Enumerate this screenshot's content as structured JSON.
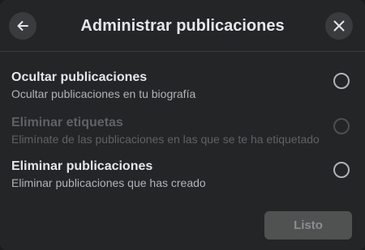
{
  "dialog": {
    "title": "Administrar publicaciones",
    "back_icon": "arrow-left-icon",
    "close_icon": "close-icon"
  },
  "options": [
    {
      "title": "Ocultar publicaciones",
      "description": "Ocultar publicaciones en tu biografía",
      "enabled": true,
      "selected": false
    },
    {
      "title": "Eliminar etiquetas",
      "description": "Elimínate de las publicaciones en las que se te ha etiquetado",
      "enabled": false,
      "selected": false
    },
    {
      "title": "Eliminar publicaciones",
      "description": "Eliminar publicaciones que has creado",
      "enabled": true,
      "selected": false
    }
  ],
  "footer": {
    "done_label": "Listo",
    "done_enabled": false
  },
  "colors": {
    "dialog_bg": "#242526",
    "button_bg": "#3a3b3c",
    "text_primary": "#e4e6eb",
    "text_secondary": "#b0b3b8",
    "disabled_text": "#5f6164"
  }
}
